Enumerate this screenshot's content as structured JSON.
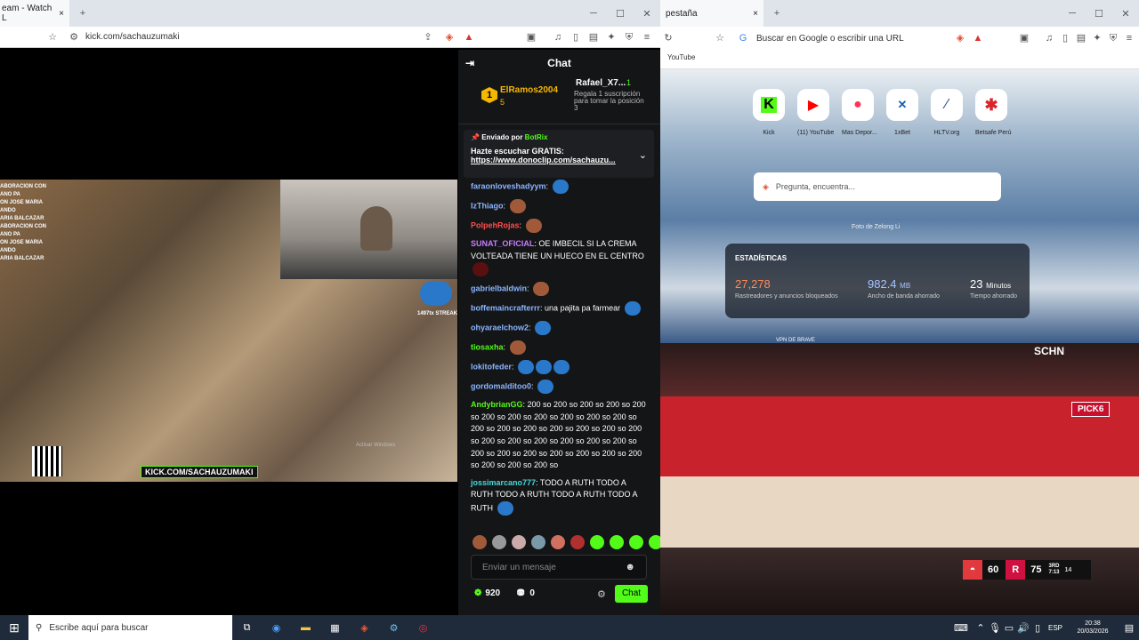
{
  "left_browser": {
    "tab_title": "eam - Watch L",
    "url": "kick.com/sachauzumaki",
    "new_tab": "+",
    "close_tab": "×"
  },
  "stream": {
    "overlay_lines": [
      "ABORACION CON",
      "ANO PA",
      "ON JOSE MARIA",
      "ANDO",
      "ARIA BALCAZAR",
      "ABORACION CON",
      "ANO PA",
      "ON JOSE MARIA",
      "ANDO",
      "ARIA BALCAZAR"
    ],
    "watermark": "KICK.COM/SACHAUZUMAKI",
    "streak": "1497tx STREAK",
    "activate_windows": "Activar Windows"
  },
  "chat": {
    "title": "Chat",
    "top_users": [
      {
        "rank": "1",
        "name": "ElRamos2004",
        "count": "5"
      },
      {
        "rank": "",
        "name": "Rafael_X7...",
        "count": "1"
      }
    ],
    "gift_text": "Regala 1 suscripción para tomar la posición 3",
    "pinned": {
      "sent_by": "Enviado por",
      "bot": "BotRix",
      "line1": "Hazte escuchar GRATIS:",
      "link": "https://www.donoclip.com/sachauzu..."
    },
    "messages": [
      {
        "user": "faraonloveshadyym",
        "text": "",
        "color": "#8ab4ff"
      },
      {
        "user": "IzThiago",
        "text": "",
        "color": "#8ab4ff"
      },
      {
        "user": "PolpehRojas",
        "text": "",
        "color": "#ff4d4d"
      },
      {
        "user": "SUNAT_OFICIAL",
        "text": "OE IMBECIL SI LA CREMA VOLTEADA TIENE UN HUECO EN EL CENTRO",
        "color": "#c77dff"
      },
      {
        "user": "gabrielbaldwin",
        "text": "",
        "color": "#8ab4ff"
      },
      {
        "user": "boffemaincrafterrr",
        "text": "una pajita pa farmear",
        "color": "#8ab4ff"
      },
      {
        "user": "ohyaraelchow2",
        "text": "",
        "color": "#8ab4ff"
      },
      {
        "user": "tiosaxha",
        "text": "",
        "color": "#53fc18"
      },
      {
        "user": "lokitofeder",
        "text": "",
        "color": "#8ab4ff"
      },
      {
        "user": "gordomalditoo0",
        "text": "",
        "color": "#8ab4ff"
      },
      {
        "user": "AndybrianGG",
        "text": "200 so 200 so 200 so 200 so 200 so 200 so 200 so 200 so 200 so 200 so 200 so 200 so 200 so 200 so 200 so 200 so 200 so 200 so 200 so 200 so 200 so 200 so 200 so 200 so 200 so 200 so 200 so 200 so 200 so 200 so 200 so 200 so 200 so 200 so",
        "color": "#53fc18"
      },
      {
        "user": "jossimarcano777",
        "text": "TODO A RUTH TODO A RUTH TODO A RUTH TODO A RUTH TODO A RUTH",
        "color": "#4ad9d9"
      }
    ],
    "input_placeholder": "Enviar un mensaje",
    "points": "920",
    "bag": "0",
    "chat_button": "Chat"
  },
  "right_browser": {
    "tab_title": "pestaña",
    "address_placeholder": "Buscar en Google o escribir una URL",
    "bookmark": "YouTube",
    "shortcuts": [
      {
        "label": "Kick",
        "color": "#53fc18"
      },
      {
        "label": "(11) YouTube",
        "color": "#ff0000"
      },
      {
        "label": "Mas Depor...",
        "color": "#ff3355"
      },
      {
        "label": "1xBet",
        "color": "#1a5fb4"
      },
      {
        "label": "HLTV.org",
        "color": "#2b4a7a"
      },
      {
        "label": "Betsafe Perú",
        "color": "#d9262c"
      }
    ],
    "search_placeholder": "Pregunta, encuentra...",
    "photo_credit": "Foto de Zelong Li",
    "stats": {
      "title": "ESTADÍSTICAS",
      "trackers": "27,278",
      "trackers_label": "Rastreadores y anuncios bloqueados",
      "bandwidth": "982.4",
      "bandwidth_unit": "MB",
      "bandwidth_label": "Ancho de banda ahorrado",
      "time": "23",
      "time_unit": "Minutos",
      "time_label": "Tiempo ahorrado"
    },
    "vpn": "VPN DE BRAVE"
  },
  "nba": {
    "away_score": "60",
    "home_score": "75",
    "quarter": "3RD",
    "clock": "7:13",
    "shot_clock": "14",
    "channel": "SCHN",
    "sponsor": "PICK6"
  },
  "taskbar": {
    "search": "Escribe aquí para buscar",
    "lang": "ESP",
    "time": "20:38",
    "date": "20/03/2026"
  }
}
